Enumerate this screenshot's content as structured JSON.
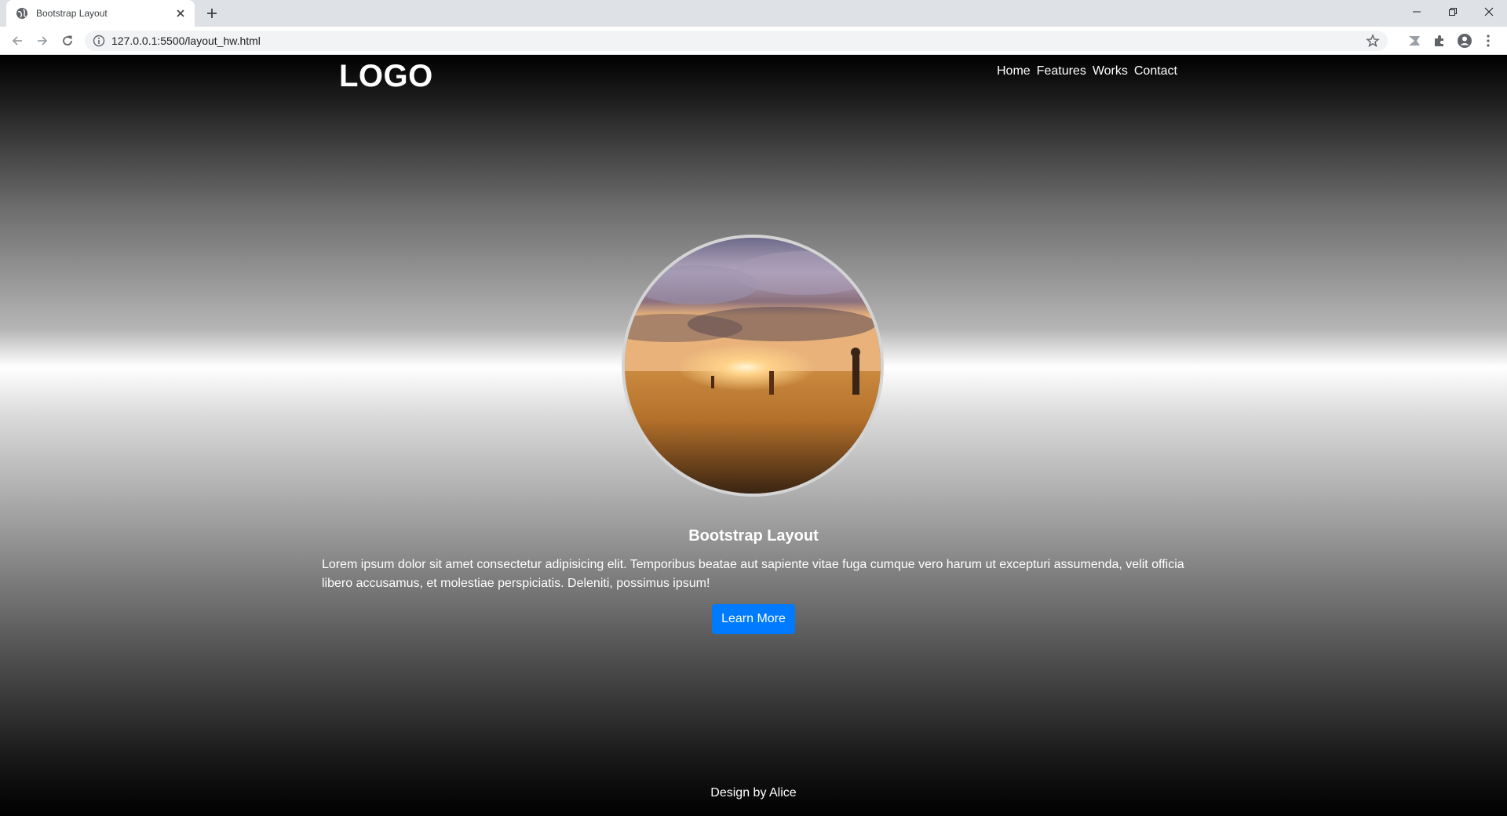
{
  "browser": {
    "tab_title": "Bootstrap Layout",
    "url": "127.0.0.1:5500/layout_hw.html"
  },
  "page": {
    "logo": "LOGO",
    "nav": [
      "Home",
      "Features",
      "Works",
      "Contact"
    ],
    "hero": {
      "title": "Bootstrap Layout",
      "text": "Lorem ipsum dolor sit amet consectetur adipisicing elit. Temporibus beatae aut sapiente vitae fuga cumque vero harum ut excepturi assumenda, velit officia libero accusamus, et molestiae perspiciatis. Deleniti, possimus ipsum!",
      "button": "Learn More"
    },
    "footer": "Design by Alice"
  },
  "colors": {
    "button": "#007bff",
    "text": "#ffffff"
  },
  "icons": {
    "tab_favicon": "globe-icon",
    "page_image": "sunset-field-photo"
  }
}
